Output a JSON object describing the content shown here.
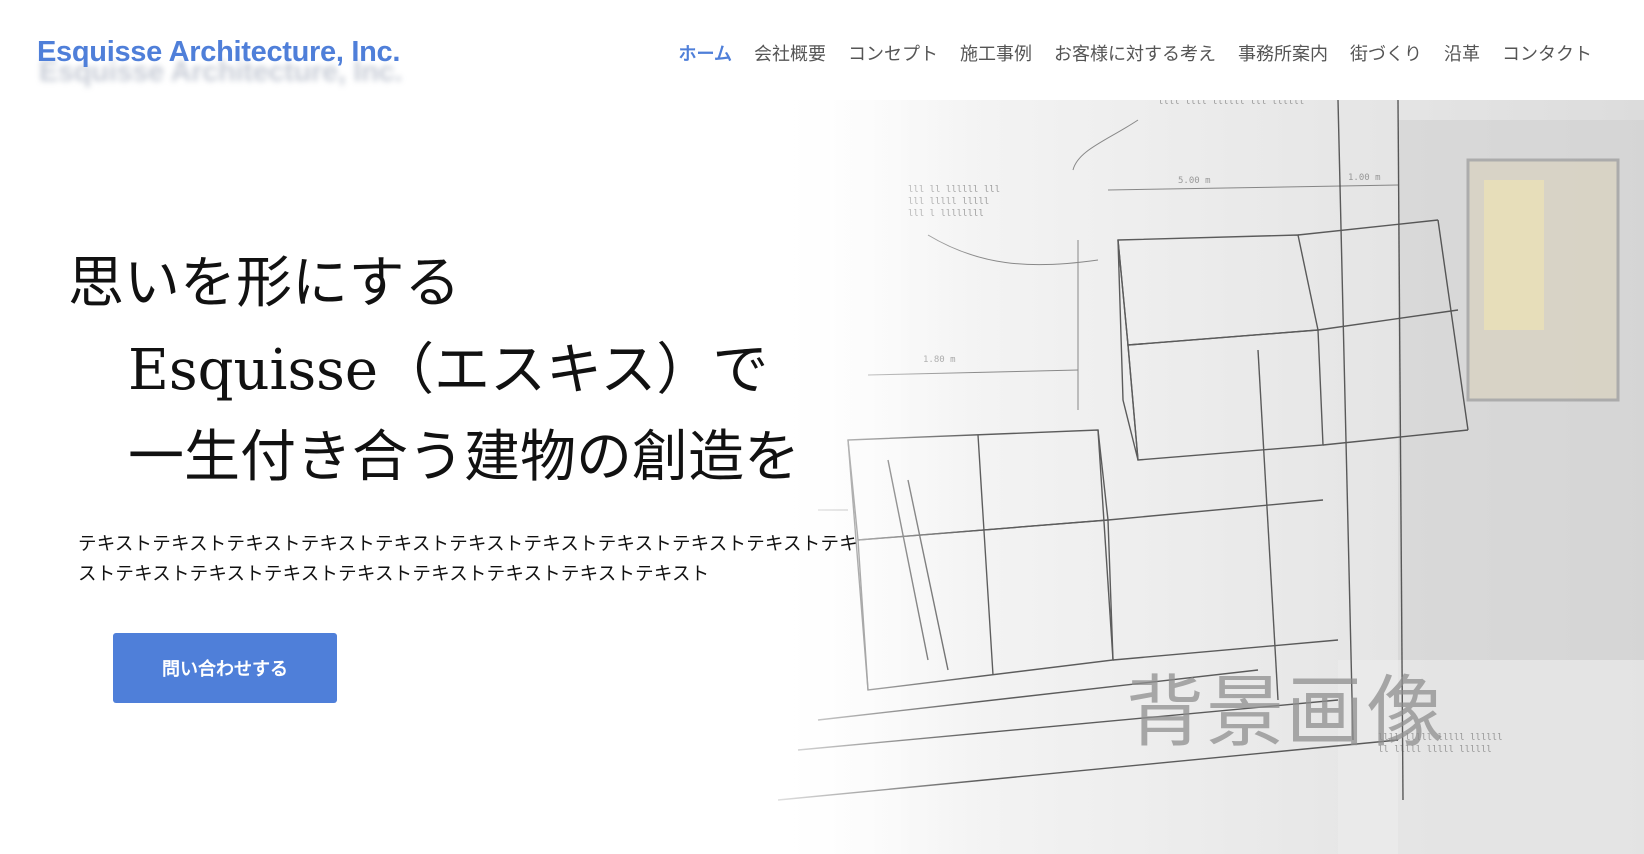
{
  "header": {
    "logo": "Esquisse Architecture, Inc.",
    "nav": [
      {
        "label": "ホーム",
        "active": true
      },
      {
        "label": "会社概要",
        "active": false
      },
      {
        "label": "コンセプト",
        "active": false
      },
      {
        "label": "施工事例",
        "active": false
      },
      {
        "label": "お客様に対する考え",
        "active": false
      },
      {
        "label": "事務所案内",
        "active": false
      },
      {
        "label": "街づくり",
        "active": false
      },
      {
        "label": "沿革",
        "active": false
      },
      {
        "label": "コンタクト",
        "active": false
      }
    ]
  },
  "hero": {
    "headline": [
      "思いを形にする",
      "Esquisse（エスキス）で",
      "一生付き合う建物の創造を"
    ],
    "body": "テキストテキストテキストテキストテキストテキストテキストテキストテキストテキストテキストテキストテキストテキストテキストテキストテキストテキストテキスト",
    "cta_label": "問い合わせする",
    "background_label": "背景画像"
  },
  "colors": {
    "accent": "#4f7fd9",
    "text": "#111111",
    "nav_text": "#555555"
  }
}
